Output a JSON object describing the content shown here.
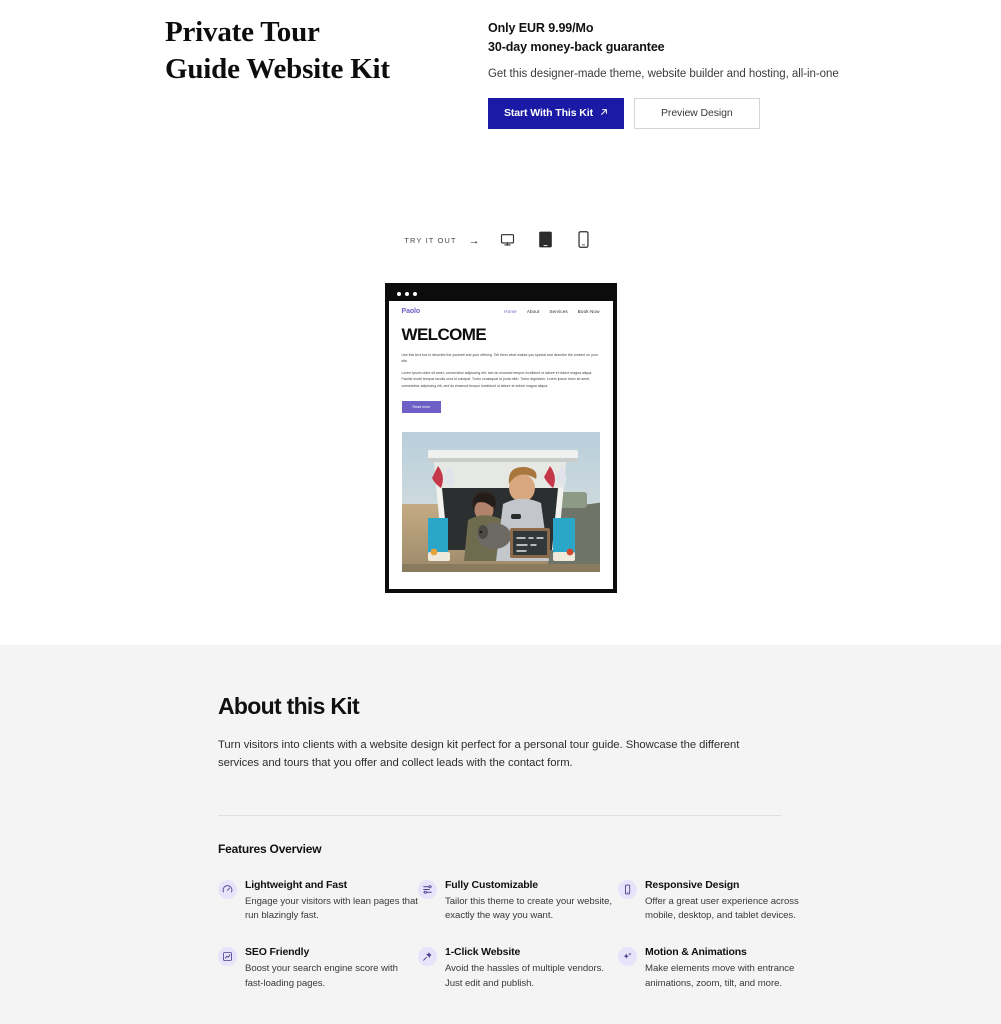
{
  "hero": {
    "title_line1": "Private Tour",
    "title_line2": "Guide Website Kit",
    "price": "Only EUR 9.99/Mo",
    "guarantee": "30-day money-back guarantee",
    "description": "Get this designer-made theme, website builder and hosting, all-in-one",
    "primary_button": "Start With This Kit",
    "primary_button_icon": "arrow-up-right-icon",
    "secondary_button": "Preview Design",
    "accent_color": "#1a1aa6"
  },
  "tryout": {
    "label": "TRY IT OUT",
    "arrow": "→",
    "devices": [
      {
        "name": "desktop",
        "icon": "desktop-icon",
        "active": false
      },
      {
        "name": "tablet",
        "icon": "tablet-icon",
        "active": true
      },
      {
        "name": "mobile",
        "icon": "mobile-icon",
        "active": false
      }
    ]
  },
  "mockup": {
    "logo": "Paolo",
    "nav": [
      "Home",
      "About",
      "Services",
      "Book Now"
    ],
    "active_nav": "Home",
    "heading": "WELCOME",
    "paragraph1": "Use this text box to describe the yourself and your offering. Tell them what makes you special and describe the content on your site.",
    "paragraph2": "Lorem ipsum dolor sit amet, consectetur adipiscing elit, sed do eiusmod tempor incididunt ut labore et dolore magna aliqua. Facilisi morbi tempus iaculis urna id volutpat. Tortor consequat id porta nibh. Tortor dignissim. Lorem ipsum dolor sit amet, consectetur adipiscing elit, sed do eiusmod tempor incididunt ut labore et dolore magna aliqua.",
    "cta": "Read more",
    "accent_color": "#6d5fc6",
    "photo_alt": "Couple with dog at a teal camper van holding a chalkboard sign"
  },
  "about": {
    "title": "About this Kit",
    "description": "Turn visitors into clients with a website design kit perfect for a personal tour guide. Showcase the different services and tours that you offer and collect leads with the contact form.",
    "features_heading": "Features Overview",
    "features": [
      {
        "icon": "gauge-icon",
        "title": "Lightweight and Fast",
        "description": "Engage your visitors with lean pages that run blazingly fast."
      },
      {
        "icon": "sliders-icon",
        "title": "Fully Customizable",
        "description": "Tailor this theme to create your website, exactly the way you want."
      },
      {
        "icon": "mobile-icon",
        "title": "Responsive Design",
        "description": "Offer a great user experience across mobile, desktop, and tablet devices."
      },
      {
        "icon": "chart-line-icon",
        "title": "SEO Friendly",
        "description": "Boost your search engine score with fast-loading pages."
      },
      {
        "icon": "pin-icon",
        "title": "1-Click Website",
        "description": "Avoid the hassles of multiple vendors. Just edit and publish."
      },
      {
        "icon": "sparkle-icon",
        "title": "Motion & Animations",
        "description": "Make elements move with entrance animations, zoom, tilt, and more."
      }
    ],
    "icon_bg_color": "#e8e3fb"
  }
}
